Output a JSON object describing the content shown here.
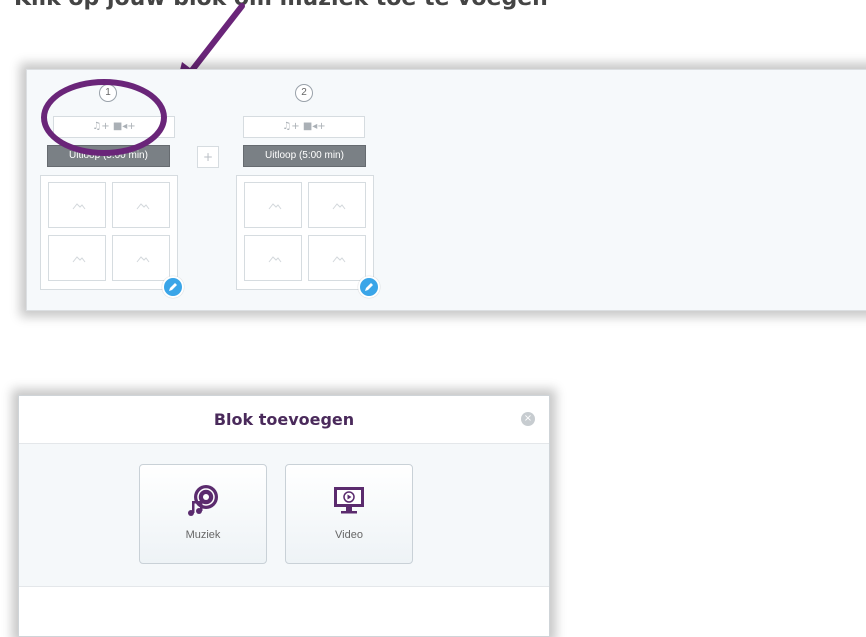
{
  "caption": "Klik op jouw blok om muziek toe te voegen",
  "blocks": [
    {
      "number": "1",
      "media_label": "♫+ ■◂+",
      "uitloop_label": "Uitloop (5:00 min)"
    },
    {
      "number": "2",
      "media_label": "♫+ ■◂+",
      "uitloop_label": "Uitloop (5:00 min)"
    }
  ],
  "add_block_symbol": "+",
  "highlight_color": "#6a2579",
  "edit_button_color": "#3aa5e8",
  "modal": {
    "title": "Blok toevoegen",
    "close_symbol": "×",
    "options": [
      {
        "label": "Muziek",
        "icon": "music-disc-icon"
      },
      {
        "label": "Video",
        "icon": "video-monitor-icon"
      }
    ]
  }
}
